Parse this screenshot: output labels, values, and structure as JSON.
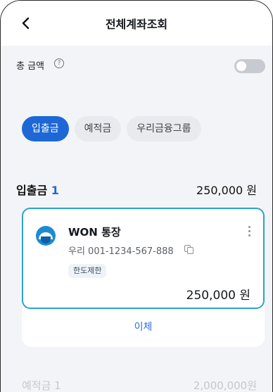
{
  "header": {
    "title": "전체계좌조회",
    "back_icon": "chevron-left-icon"
  },
  "total_amount": {
    "label": "총 금액",
    "help_icon": "?",
    "toggle_on": false
  },
  "tabs": [
    {
      "label": "입출금",
      "active": true
    },
    {
      "label": "예적금",
      "active": false
    },
    {
      "label": "우리금융그룹",
      "active": false
    }
  ],
  "section": {
    "title": "입출금",
    "count": "1",
    "total": "250,000 원"
  },
  "account": {
    "name": "WON 통장",
    "number": "우리 001-1234-567-888",
    "badge": "한도제한",
    "balance": "250,000 원",
    "transfer_label": "이체"
  },
  "next_section": {
    "title": "예적금 1",
    "total": "2,000,000원"
  },
  "colors": {
    "accent": "#1d68d6",
    "card_border": "#2ba3cf",
    "background": "#f3f4f7"
  }
}
